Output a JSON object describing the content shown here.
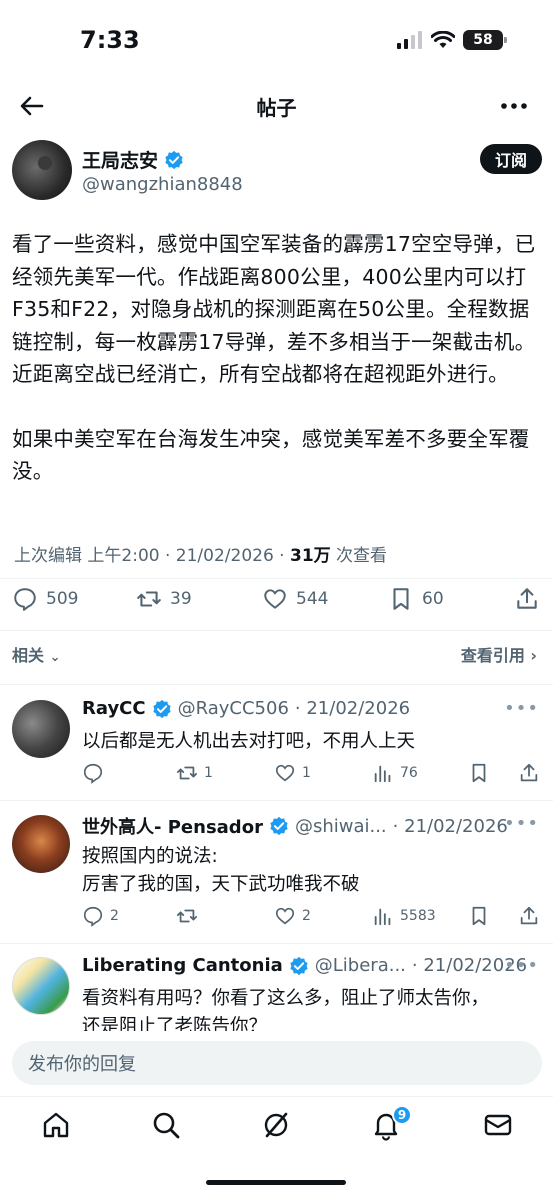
{
  "status_bar": {
    "time": "7:33",
    "battery": "58"
  },
  "header": {
    "title": "帖子"
  },
  "author": {
    "name": "王局志安",
    "handle": "@wangzhian8848",
    "subscribe_label": "订阅"
  },
  "post": {
    "paragraph1": "看了一些资料，感觉中国空军装备的霹雳17空空导弹，已经领先美军一代。作战距离800公里，400公里内可以打F35和F22，对隐身战机的探测距离在50公里。全程数据链控制，每一枚霹雳17导弹，差不多相当于一架截击机。近距离空战已经消亡，所有空战都将在超视距外进行。",
    "paragraph2": "如果中美空军在台海发生冲突，感觉美军差不多要全军覆没。",
    "meta_prefix": "上次编辑 上午2:00 · 21/02/2026 · ",
    "views": "31万",
    "views_suffix": " 次查看",
    "replies": "509",
    "reposts": "39",
    "likes": "544",
    "bookmarks": "60"
  },
  "related": {
    "left": "相关",
    "right": "查看引用"
  },
  "replies": [
    {
      "name": "RayCC",
      "handle": "@RayCC506",
      "date": "· 21/02/2026",
      "text": "以后都是无人机出去对打吧，不用人上天",
      "replies": "",
      "reposts": "1",
      "likes": "1",
      "views": "76"
    },
    {
      "name": "世外高人- Pensador",
      "handle": "@shiwai...",
      "date": "· 21/02/2026",
      "text_line1": "按照国内的说法:",
      "text_line2": "厉害了我的国，天下武功唯我不破",
      "replies": "2",
      "reposts": "",
      "likes": "2",
      "views": "5583"
    },
    {
      "name": "Liberating Cantonia",
      "handle": "@Libera...",
      "date": "· 21/02/2026",
      "text_line1": "看资料有用吗？你看了这么多，阻止了师太告你，",
      "text_line2": "还是阻止了老陈告你？"
    }
  ],
  "composer": {
    "placeholder": "发布你的回复"
  },
  "bottom_nav": {
    "notification_count": "9"
  },
  "colors": {
    "accent": "#1d9bf0",
    "text": "#0f1419",
    "muted": "#536471"
  }
}
